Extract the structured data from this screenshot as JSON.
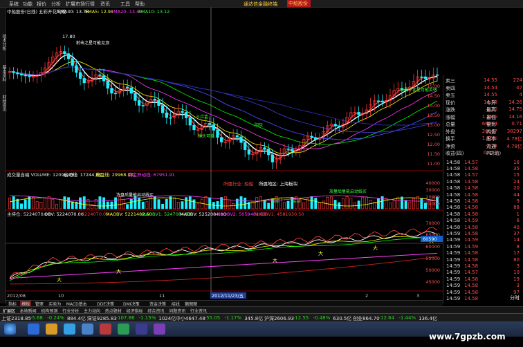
{
  "menubar": {
    "items": [
      "系统",
      "功能",
      "报价",
      "分析",
      "扩展市场行情",
      "资讯",
      "工具",
      "帮助"
    ],
    "alert": "通达信金融终端",
    "stock": "中船股份"
  },
  "sidebar": {
    "items": [
      "技术分析",
      "基本资料",
      "财经资讯"
    ]
  },
  "main_chart": {
    "title": "中船股份(日线) 五彩开花均线",
    "ema30": "EMA30: 13.76",
    "ema5": "EMA5: 12.91",
    "ema20": "EMA20: 13.49",
    "ema10": "EMA10: 13.12",
    "high_label": "17.80",
    "annotation1": "射击之星可能见顶",
    "annotation2": "三兵连",
    "annotation3": "锤头可能",
    "annotation4": "阴包",
    "annotation5": "早晨十字星可能反转",
    "y_ticks": [
      "15.00",
      "14.50",
      "14.00",
      "13.50",
      "13.00",
      "12.50",
      "12.00",
      "11.50",
      "11.00"
    ]
  },
  "volume_chart": {
    "title": "成交量自编 VOLUME: 12096.75",
    "avg1": "启动线: 17244.80",
    "avg2": "洗盘线: 29968.00",
    "avg3": "资金异动线: 67951.91",
    "label1": "所属行业: 船舶",
    "label2": "所属地区: 上海板块",
    "label3": "洗盘后量能启动线买",
    "label4": "放量后量能启动线买",
    "buy1": "买买",
    "buy2": "买买",
    "y_ticks": [
      "40000",
      "30000",
      "20000",
      "10000"
    ]
  },
  "obv_chart": {
    "title": "主持仓: 5224070.00",
    "obv": "OBV: 5224070.00",
    "v1": "5224070.00",
    "maobv1": "MAOBV: 5221482.50",
    "maobv1b": "MAOBV1: 5247084.50",
    "maobv2": "MAOBV: 5252084.00",
    "maobv2b": "MAOBV2: 5059482.50",
    "maobv3": "MAOBV1: 4581930.50",
    "current": "60590",
    "y_ticks": [
      "70000",
      "65000",
      "60000",
      "55000",
      "50000",
      "45000"
    ],
    "x_ticks": [
      "2012/08",
      "10",
      "11",
      "2012/11/23/五",
      "2",
      "3"
    ],
    "star_label": "大"
  },
  "quote": {
    "rows": [
      {
        "l": "卖三",
        "v": "14.55",
        "v2": "224"
      },
      {
        "l": "卖四",
        "v": "14.54",
        "v2": "47"
      },
      {
        "l": "卖五",
        "v": "14.55",
        "v2": "4"
      },
      {
        "l": "现价",
        "v": "14.58",
        "l2": "今开",
        "v3": "14.26"
      },
      {
        "l": "涨跌",
        "v": "0.20",
        "l2": "最高",
        "v3": "14.75"
      },
      {
        "l": "涨幅",
        "v": "1.39%",
        "l2": "最低",
        "v3": "14.16"
      },
      {
        "l": "总量",
        "v": "66964",
        "l2": "量比",
        "v3": "0.71"
      },
      {
        "l": "外盘",
        "v": "28667",
        "l2": "内盘",
        "v3": "38297"
      },
      {
        "l": "换手",
        "v": "1.40%",
        "l2": "股本",
        "v3": "4.78亿"
      },
      {
        "l": "净资",
        "v": "2.76",
        "l2": "流通",
        "v3": "4.78亿"
      },
      {
        "l": "收益(四)",
        "v": "0.159",
        "l2": "PE(动)",
        "v3": ""
      }
    ],
    "ticks": [
      {
        "t": "14:58",
        "p": "14.57",
        "v": "16"
      },
      {
        "t": "14:58",
        "p": "14.58",
        "v": "35"
      },
      {
        "t": "14:58",
        "p": "14.57",
        "v": "15"
      },
      {
        "t": "14:58",
        "p": "14.58",
        "v": "24"
      },
      {
        "t": "14:58",
        "p": "14.58",
        "v": "20"
      },
      {
        "t": "14:58",
        "p": "14.58",
        "v": "44"
      },
      {
        "t": "14:58",
        "p": "14.58",
        "v": "9"
      },
      {
        "t": "14:58",
        "p": "14.58",
        "v": "88"
      },
      {
        "t": "14:58",
        "p": "14.58",
        "v": "1"
      },
      {
        "t": "14:58",
        "p": "14.59",
        "v": "6"
      },
      {
        "t": "14:58",
        "p": "14.58",
        "v": "40"
      },
      {
        "t": "14:59",
        "p": "14.58",
        "v": "37"
      },
      {
        "t": "14:59",
        "p": "14.59",
        "v": "14"
      },
      {
        "t": "14:59",
        "p": "14.59",
        "v": "8"
      },
      {
        "t": "14:59",
        "p": "14.58",
        "v": "17"
      },
      {
        "t": "14:59",
        "p": "14.58",
        "v": "80"
      },
      {
        "t": "14:59",
        "p": "14.58",
        "v": "3"
      },
      {
        "t": "14:59",
        "p": "14.57",
        "v": "10"
      },
      {
        "t": "14:59",
        "p": "14.58",
        "v": "19"
      },
      {
        "t": "14:59",
        "p": "14.58",
        "v": "3"
      },
      {
        "t": "14:59",
        "p": "14.58",
        "v": "97"
      },
      {
        "t": "14:59",
        "p": "14.58",
        "v": "1"
      }
    ],
    "footer": "分时"
  },
  "tabs": [
    "指标",
    "模板",
    "管理",
    "买卖为",
    "MACD基本",
    "DDE决策",
    "DMI决策",
    "资金决策",
    "招线",
    "额图图"
  ],
  "tabs2": [
    "扩展区",
    "本地新闻",
    "机构预测",
    "行业分析",
    "主力动向",
    "热点题材",
    "经济指标",
    "综合资讯",
    "问题资讯",
    "行业资讯"
  ],
  "status": {
    "items": [
      {
        "label": "上证2318.85",
        "color": "#e0e0e0"
      },
      {
        "label": "-5.68",
        "color": "#2bd02b"
      },
      {
        "label": "-0.24%",
        "color": "#2bd02b"
      },
      {
        "label": "884.4亿",
        "color": "#e0e0e0"
      },
      {
        "label": "深证9285.83",
        "color": "#e0e0e0"
      },
      {
        "label": "-107.86",
        "color": "#2bd02b"
      },
      {
        "label": "-1.15%",
        "color": "#2bd02b"
      },
      {
        "label": "1024亿",
        "color": "#e0e0e0"
      },
      {
        "label": "中小4647.48",
        "color": "#e0e0e0"
      },
      {
        "label": "-55.05",
        "color": "#2bd02b"
      },
      {
        "label": "-1.17%",
        "color": "#2bd02b"
      },
      {
        "label": "345.8亿",
        "color": "#e0e0e0"
      },
      {
        "label": "沪深2606.93",
        "color": "#e0e0e0"
      },
      {
        "label": "-12.55",
        "color": "#2bd02b"
      },
      {
        "label": "-0.48%",
        "color": "#2bd02b"
      },
      {
        "label": "630.5亿",
        "color": "#e0e0e0"
      },
      {
        "label": "创业864.70",
        "color": "#e0e0e0"
      },
      {
        "label": "-12.64",
        "color": "#2bd02b"
      },
      {
        "label": "-1.44%",
        "color": "#2bd02b"
      },
      {
        "label": "136.4亿",
        "color": "#e0e0e0"
      }
    ]
  },
  "watermark": "www.7gpzb.com",
  "colors": {
    "up": "#ff3b3b",
    "down": "#1ff0ff",
    "ema5": "#ffffff",
    "ema10": "#ffff00",
    "ema20": "#ff40ff",
    "ema30": "#00ff00"
  }
}
